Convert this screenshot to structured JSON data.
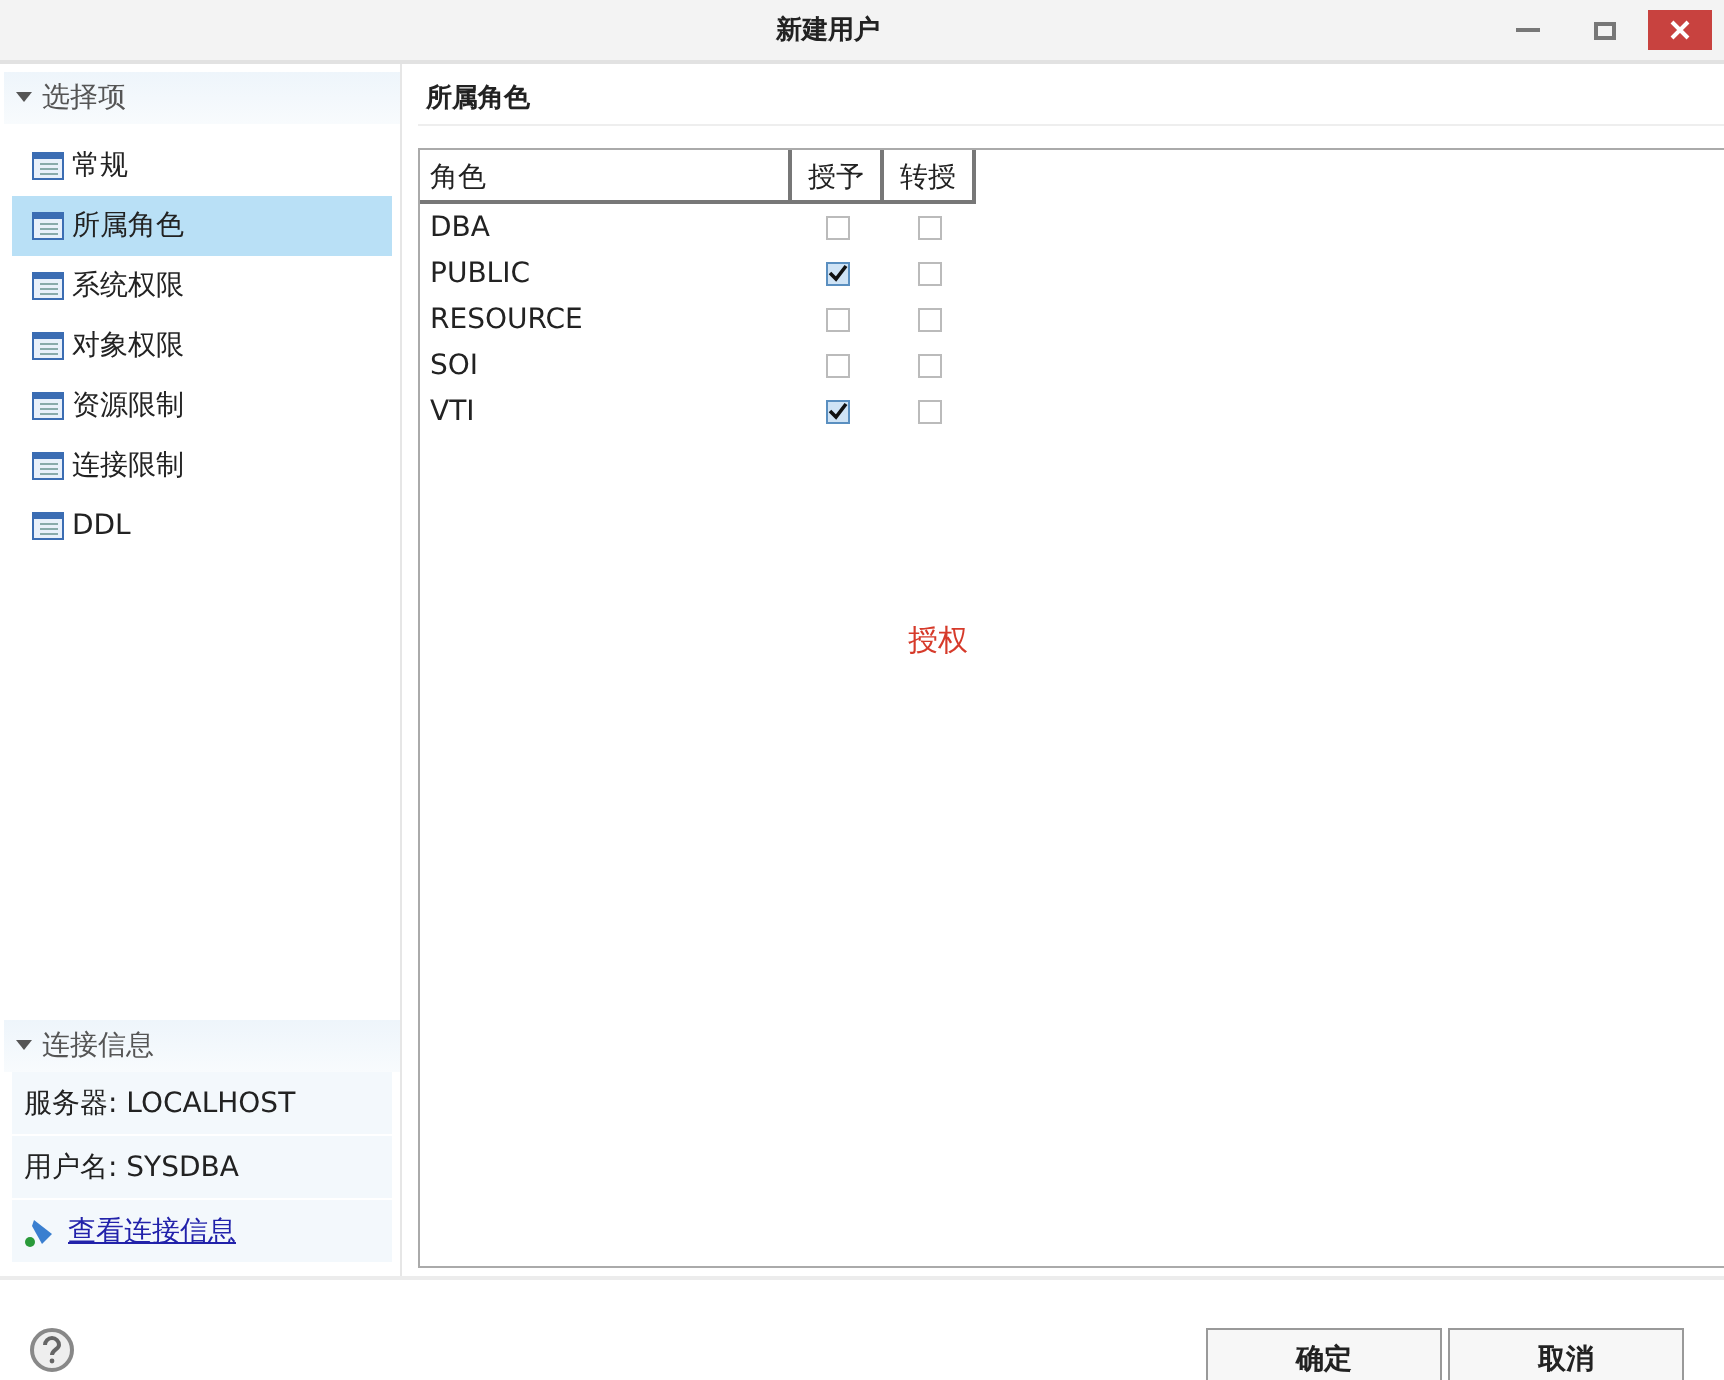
{
  "window": {
    "title": "新建用户"
  },
  "sidebar": {
    "section_title": "选择项",
    "expanded": true,
    "items": [
      {
        "label": "常规",
        "selected": false
      },
      {
        "label": "所属角色",
        "selected": true
      },
      {
        "label": "系统权限",
        "selected": false
      },
      {
        "label": "对象权限",
        "selected": false
      },
      {
        "label": "资源限制",
        "selected": false
      },
      {
        "label": "连接限制",
        "selected": false
      },
      {
        "label": "DDL",
        "selected": false
      }
    ]
  },
  "connection": {
    "section_title": "连接信息",
    "expanded": true,
    "server": "服务器: LOCALHOST",
    "user": "用户名: SYSDBA",
    "link": "查看连接信息"
  },
  "panel": {
    "title": "所属角色",
    "table": {
      "columns": [
        "角色",
        "授予",
        "转授"
      ],
      "rows": [
        {
          "role": "DBA",
          "grant": false,
          "delegate": false
        },
        {
          "role": "PUBLIC",
          "grant": true,
          "delegate": false
        },
        {
          "role": "RESOURCE",
          "grant": false,
          "delegate": false
        },
        {
          "role": "SOI",
          "grant": false,
          "delegate": false
        },
        {
          "role": "VTI",
          "grant": true,
          "delegate": false
        }
      ]
    },
    "note": "授权"
  },
  "buttons": [
    "确定",
    "取消"
  ]
}
